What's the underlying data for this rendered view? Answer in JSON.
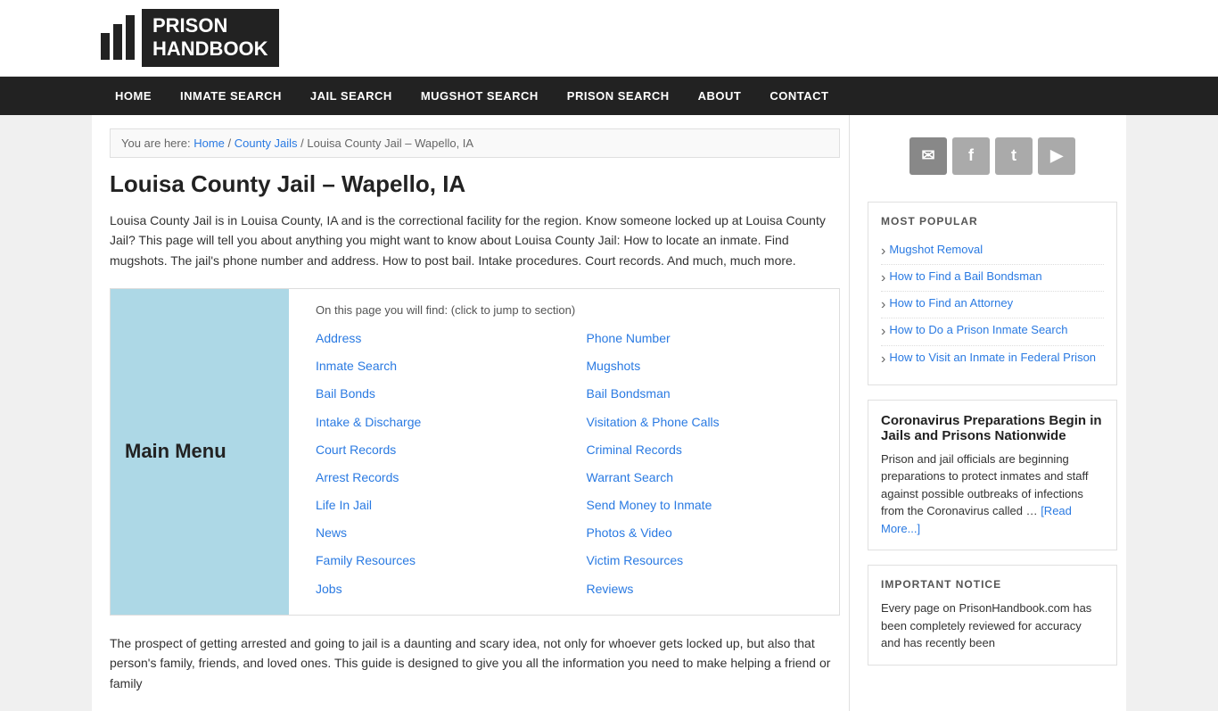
{
  "header": {
    "logo_text_line1": "PRISON",
    "logo_text_line2": "HANDBOOK"
  },
  "nav": {
    "items": [
      {
        "label": "HOME",
        "href": "#"
      },
      {
        "label": "INMATE SEARCH",
        "href": "#"
      },
      {
        "label": "JAIL SEARCH",
        "href": "#"
      },
      {
        "label": "MUGSHOT SEARCH",
        "href": "#"
      },
      {
        "label": "PRISON SEARCH",
        "href": "#"
      },
      {
        "label": "ABOUT",
        "href": "#"
      },
      {
        "label": "CONTACT",
        "href": "#"
      }
    ]
  },
  "breadcrumb": {
    "you_are_here": "You are here:",
    "home": "Home",
    "county_jails": "County Jails",
    "current": "Louisa County Jail – Wapello, IA"
  },
  "content": {
    "page_title": "Louisa County Jail – Wapello, IA",
    "intro": "Louisa County Jail is in Louisa County, IA and is the correctional facility for the region. Know someone locked up at Louisa County Jail? This page will tell you about anything you might want to know about Louisa County Jail: How to locate an inmate. Find mugshots. The jail's phone number and address. How to post bail. Intake procedures. Court records. And much, much more.",
    "menu_title": "Main Menu",
    "jump_text": "On this page you will find: (click to jump to section)",
    "menu_links": [
      {
        "label": "Address",
        "col": 1
      },
      {
        "label": "Phone Number",
        "col": 2
      },
      {
        "label": "Inmate Search",
        "col": 1
      },
      {
        "label": "Mugshots",
        "col": 2
      },
      {
        "label": "Bail Bonds",
        "col": 1
      },
      {
        "label": "Bail Bondsman",
        "col": 2
      },
      {
        "label": "Intake & Discharge",
        "col": 1
      },
      {
        "label": "Visitation & Phone Calls",
        "col": 2
      },
      {
        "label": "Court Records",
        "col": 1
      },
      {
        "label": "Criminal Records",
        "col": 2
      },
      {
        "label": "Arrest Records",
        "col": 1
      },
      {
        "label": "Warrant Search",
        "col": 2
      },
      {
        "label": "Life In Jail",
        "col": 1
      },
      {
        "label": "Send Money to Inmate",
        "col": 2
      },
      {
        "label": "News",
        "col": 1
      },
      {
        "label": "Photos & Video",
        "col": 2
      },
      {
        "label": "Family Resources",
        "col": 1
      },
      {
        "label": "Victim Resources",
        "col": 2
      },
      {
        "label": "Jobs",
        "col": 1
      },
      {
        "label": "Reviews",
        "col": 2
      }
    ],
    "footer_text": "The prospect of getting arrested and going to jail is a daunting and scary idea, not only for whoever gets locked up, but also that person's family, friends, and loved ones. This guide is designed to give you all the information you need to make helping a friend or family"
  },
  "sidebar": {
    "social": {
      "email_icon": "✉",
      "facebook_icon": "f",
      "twitter_icon": "t",
      "youtube_icon": "▶"
    },
    "most_popular": {
      "heading": "MOST POPULAR",
      "items": [
        {
          "label": "Mugshot Removal",
          "href": "#"
        },
        {
          "label": "How to Find a Bail Bondsman",
          "href": "#"
        },
        {
          "label": "How to Find an Attorney",
          "href": "#"
        },
        {
          "label": "How to Do a Prison Inmate Search",
          "href": "#"
        },
        {
          "label": "How to Visit an Inmate in Federal Prison",
          "href": "#"
        }
      ]
    },
    "news": {
      "title": "Coronavirus Preparations Begin in Jails and Prisons Nationwide",
      "text": "Prison and jail officials are beginning preparations to protect inmates and staff against possible outbreaks of infections from the Coronavirus called … ",
      "read_more": "[Read More...]"
    },
    "important_notice": {
      "heading": "IMPORTANT NOTICE",
      "text": "Every page on PrisonHandbook.com has been completely reviewed for accuracy and has recently been"
    }
  }
}
